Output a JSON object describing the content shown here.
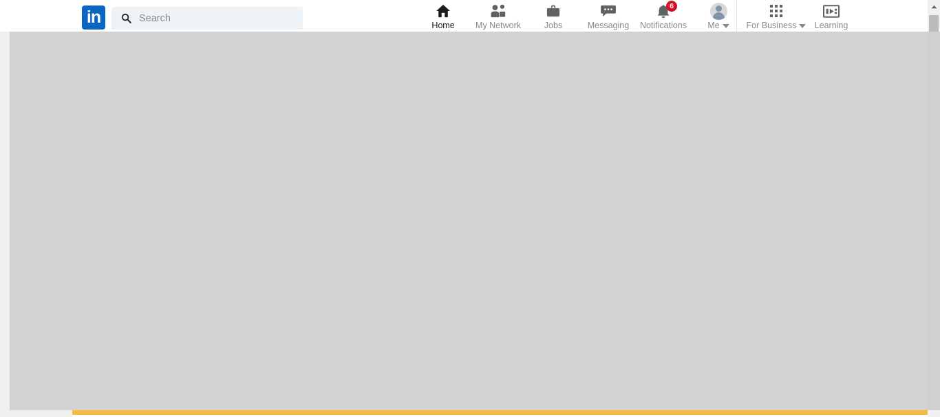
{
  "brand": {
    "logo_text": "in",
    "logo_color": "#0b65c2"
  },
  "search": {
    "placeholder": "Search",
    "value": "",
    "icon": "search-icon"
  },
  "nav_main": [
    {
      "label": "Home",
      "icon": "home-icon",
      "active": true
    },
    {
      "label": "My Network",
      "icon": "people-icon",
      "active": false
    },
    {
      "label": "Jobs",
      "icon": "briefcase-icon",
      "active": false
    },
    {
      "label": "Messaging",
      "icon": "chat-bubble-icon",
      "active": false
    },
    {
      "label": "Notifications",
      "icon": "bell-icon",
      "active": false,
      "badge": "6"
    },
    {
      "label": "Me",
      "icon": "avatar-icon",
      "active": false,
      "caret": true
    }
  ],
  "nav_right": [
    {
      "label": "For Business",
      "icon": "grid-icon",
      "caret": true
    },
    {
      "label": "Learning",
      "icon": "learning-icon",
      "caret": false
    }
  ],
  "colors": {
    "badge": "#d11124",
    "accent_bar": "#f6bc42",
    "canvas": "#d2d2d2",
    "search_bg": "#eef3f8",
    "nav_label": "#86888a",
    "nav_label_active": "#1c1c1c"
  },
  "content": {
    "body_text": ""
  }
}
